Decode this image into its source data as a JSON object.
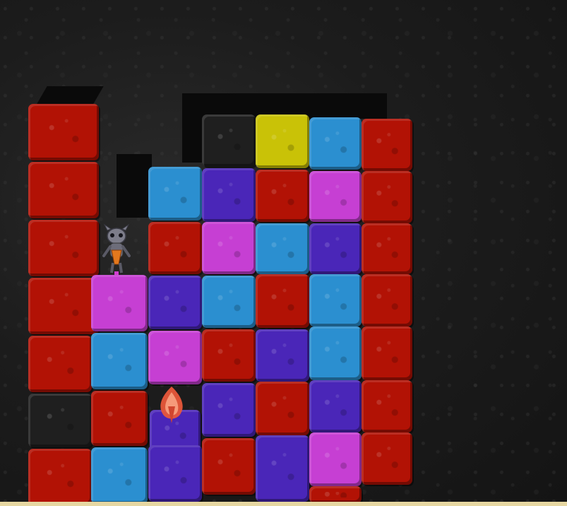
{
  "scene": {
    "title": "",
    "colors": {
      "red": "#b21205",
      "blue": "#2b8fd0",
      "purple": "#4a26b8",
      "magenta": "#c63fd3",
      "yellow": "#c9c207",
      "black": "#1f1f1f"
    }
  },
  "player": {
    "icon": "robot-icon"
  },
  "pickup": {
    "icon": "flame-gem-icon"
  }
}
